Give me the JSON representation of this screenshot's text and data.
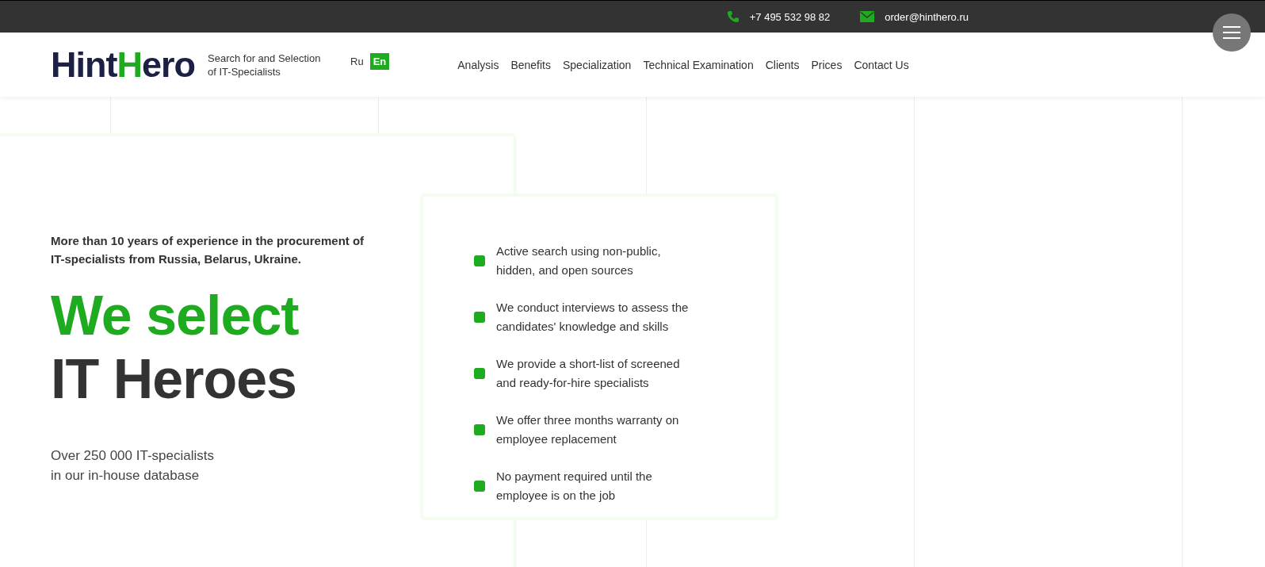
{
  "top_bar": {
    "phone": "+7 495 532 98 82",
    "email": "order@hinthero.ru"
  },
  "header": {
    "logo": [
      "Hint",
      "H",
      "ero"
    ],
    "tagline": "Search for and Selection of IT-Specialists",
    "languages": [
      {
        "label": "Ru",
        "selected": false
      },
      {
        "label": "En",
        "selected": true
      }
    ],
    "nav": [
      "Analysis",
      "Benefits",
      "Specialization",
      "Technical Examination",
      "Clients",
      "Prices",
      "Contact Us"
    ]
  },
  "hero": {
    "intro": "More than 10 years of experience in the procurement of IT-specialists from Russia, Belarus, Ukraine.",
    "headline_1": "We select",
    "headline_2": "IT Heroes",
    "note": "Over 250 000 IT-specialists in our in-house database"
  },
  "features": [
    "Active search using non-public, hidden, and open sources",
    "We conduct interviews to assess the candidates' knowledge and skills",
    "We provide a short-list of screened and ready-for-hire specialists",
    "We offer three months warranty on employee replacement",
    "No payment required until the employee is on the job"
  ]
}
